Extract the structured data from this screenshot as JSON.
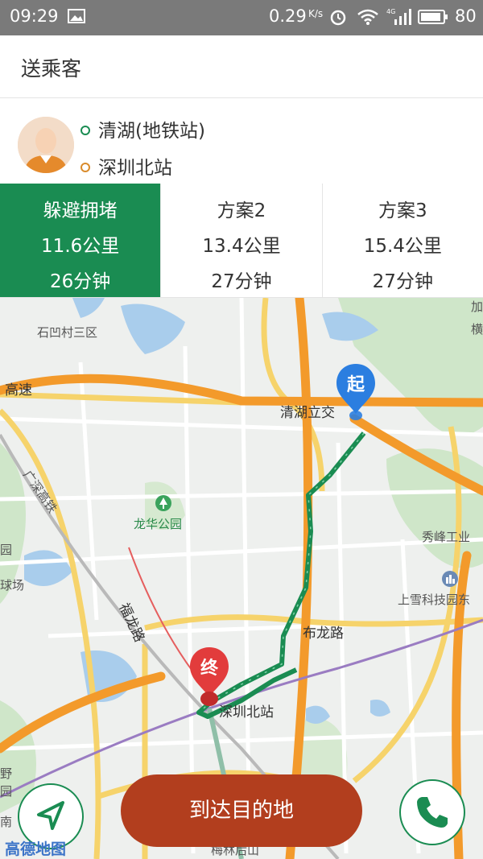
{
  "status_bar": {
    "time": "09:29",
    "speed": "0.29",
    "speed_unit": "K/s",
    "network": "4G",
    "battery": "80"
  },
  "header": {
    "title": "送乘客"
  },
  "route": {
    "start": "清湖(地铁站)",
    "end": "深圳北站",
    "start_color": "#1a8c52",
    "end_color": "#d98b2b"
  },
  "plans": [
    {
      "name": "躲避拥堵",
      "distance": "11.6公里",
      "duration": "26分钟",
      "active": true
    },
    {
      "name": "方案2",
      "distance": "13.4公里",
      "duration": "27分钟",
      "active": false
    },
    {
      "name": "方案3",
      "distance": "15.4公里",
      "duration": "27分钟",
      "active": false
    }
  ],
  "map": {
    "labels": {
      "shiao": "石凹村三区",
      "highway": "高速",
      "qinghu": "清湖立交",
      "longhua_park": "龙华公园",
      "guangshen": "广深高铁",
      "xiufeng": "秀峰工业",
      "shangxue": "上雪科技园东",
      "fulong": "福龙路",
      "bulong": "布龙路",
      "shenzhen_north": "深圳北站",
      "meilin": "梅林后山",
      "edge_yuan": "园",
      "edge_chang": "球场",
      "edge_ye": "野",
      "edge_wild": "园",
      "edge_nan": "南",
      "edge_jia": "加",
      "edge_heng": "横"
    },
    "start_marker": "起",
    "end_marker": "终",
    "route_color": "#1a8c52",
    "highway_color": "#f39a2b"
  },
  "buttons": {
    "arrive": "到达目的地"
  },
  "logo": "高德地图"
}
